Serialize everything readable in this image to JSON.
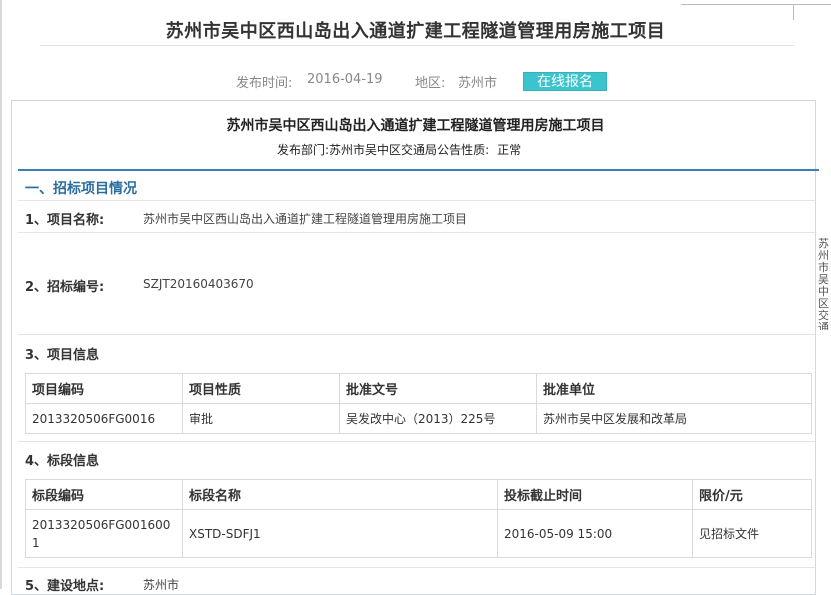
{
  "header": {
    "title": "苏州市吴中区西山岛出入通道扩建工程隧道管理用房施工项目",
    "date_label": "发布时间:",
    "date": "2016-04-19",
    "region_label": "地区:",
    "region": "苏州市",
    "signup_label": "在线报名"
  },
  "notice": {
    "title": "苏州市吴中区西山岛出入通道扩建工程隧道管理用房施工项目",
    "dept_label": "发布部门:",
    "dept": "苏州市吴中区交通局",
    "nature_label": "公告性质:",
    "nature": "正常",
    "section_title": "一、招标项目情况",
    "project_name_label": "1、项目名称:",
    "project_name": "苏州市吴中区西山岛出入通道扩建工程隧道管理用房施工项目",
    "bid_no_label": "2、招标编号:",
    "bid_no": "SZJT20160403670",
    "project_info_label": "3、项目信息",
    "project_table": {
      "headers": [
        "项目编码",
        "项目性质",
        "批准文号",
        "批准单位"
      ],
      "row": [
        "2013320506FG0016",
        "审批",
        "吴发改中心（2013）225号",
        "苏州市吴中区发展和改革局"
      ]
    },
    "lot_info_label": "4、标段信息",
    "lot_table": {
      "headers": [
        "标段编码",
        "标段名称",
        "投标截止时间",
        "限价/元"
      ],
      "row": [
        "2013320506FG0016001",
        "XSTD-SDFJ1",
        "2016-05-09 15:00",
        "见招标文件"
      ]
    },
    "location_label": "5、建设地点:",
    "location": "苏州市"
  },
  "side_text": "苏州市吴中区交通局公告性质:正常SZ"
}
